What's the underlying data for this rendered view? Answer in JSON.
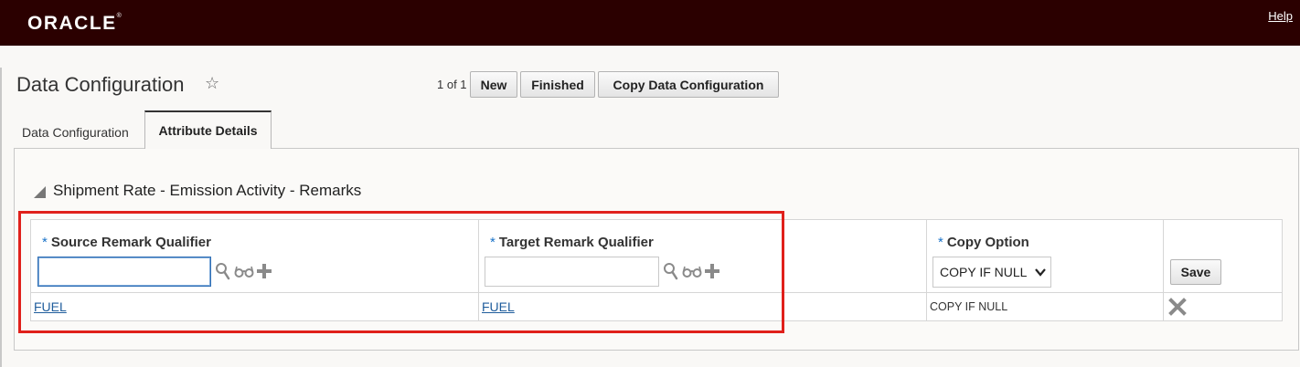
{
  "header": {
    "logo": "ORACLE",
    "logo_mark": "®",
    "help_label": "Help"
  },
  "page": {
    "title": "Data Configuration",
    "favorite_icon": "star-outline-icon",
    "pager_text": "1 of 1"
  },
  "toolbar": {
    "new_label": "New",
    "finished_label": "Finished",
    "copy_label": "Copy Data Configuration"
  },
  "tabs": [
    {
      "label": "Data Configuration",
      "active": false
    },
    {
      "label": "Attribute Details",
      "active": true
    }
  ],
  "section": {
    "title": "Shipment Rate - Emission Activity - Remarks",
    "collapse_icon": "triangle-expanded-icon"
  },
  "table": {
    "columns": [
      {
        "label": "Source Remark Qualifier",
        "required": "*"
      },
      {
        "label": "Target Remark Qualifier",
        "required": "*"
      },
      {
        "label": "Copy Option",
        "required": "*"
      }
    ],
    "new_row": {
      "source_value": "",
      "target_value": "",
      "copy_option": "COPY IF NULL",
      "save_label": "Save"
    },
    "rows": [
      {
        "source": "FUEL",
        "target": "FUEL",
        "copy_option": "COPY IF NULL"
      }
    ]
  },
  "colors": {
    "header_bg": "#2b0000",
    "highlight": "#e0201b",
    "required": "#1a73c8",
    "link": "#1f5d9c"
  }
}
